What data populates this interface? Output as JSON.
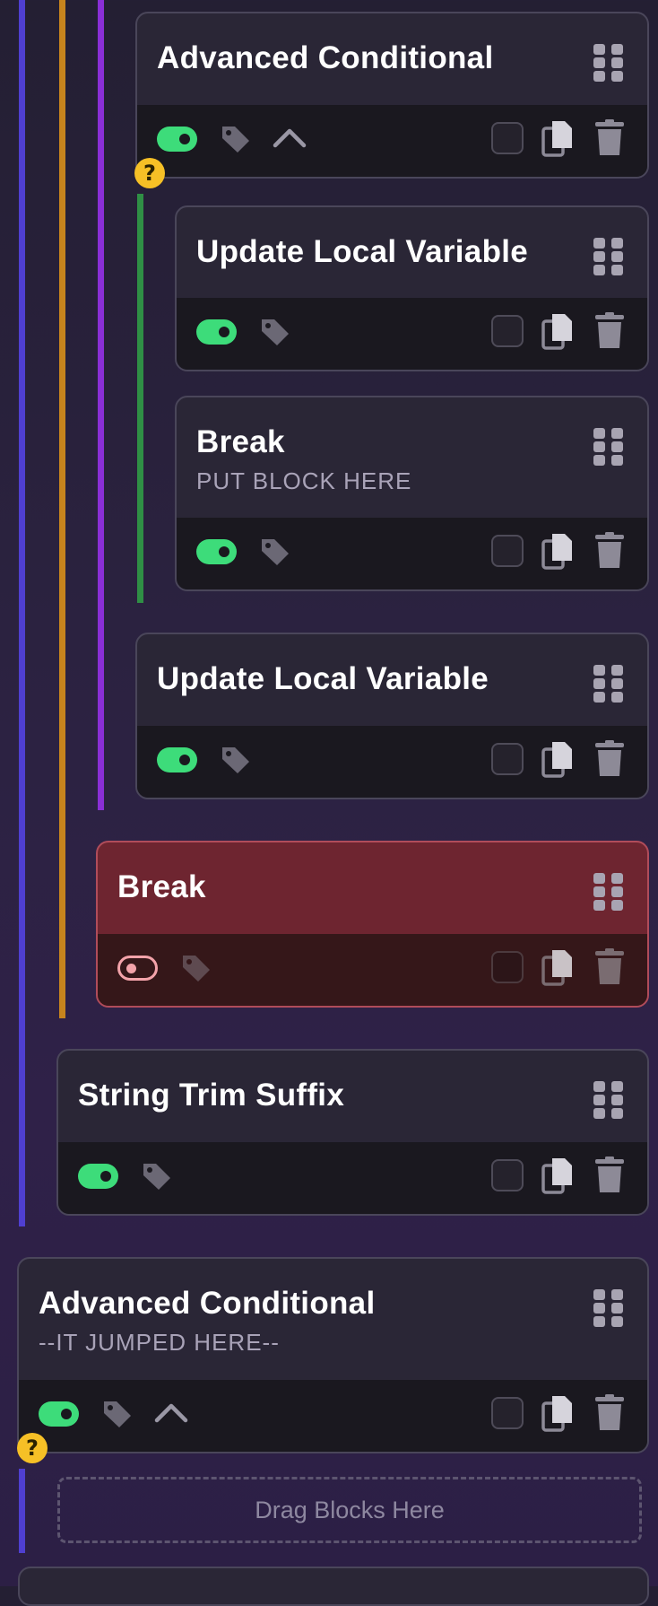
{
  "colors": {
    "nest_line_outer": "#4f3fd0",
    "nest_line_mid": "#c7841d",
    "nest_line_inner": "#8a2fd6",
    "nest_line_green": "#2f8f45",
    "toggle_on": "#3ddc7a",
    "badge": "#f6c026",
    "error_block": "#6e2530"
  },
  "blocks": [
    {
      "title": "Advanced Conditional",
      "enabled": true,
      "icons": [
        "tag-icon",
        "chevron-up-icon"
      ]
    },
    {
      "title": "Update Local Variable",
      "enabled": true,
      "icons": [
        "tag-icon"
      ]
    },
    {
      "title": "Break",
      "subtitle": "PUT BLOCK HERE",
      "enabled": true,
      "icons": [
        "tag-icon"
      ]
    },
    {
      "title": "Update Local Variable",
      "enabled": true,
      "icons": [
        "tag-icon"
      ]
    },
    {
      "title": "Break",
      "enabled": false,
      "state": "error",
      "icons": [
        "tag-icon"
      ]
    },
    {
      "title": "String Trim Suffix",
      "enabled": true,
      "icons": [
        "tag-icon"
      ]
    },
    {
      "title": "Advanced Conditional",
      "subtitle": "--IT JUMPED HERE--",
      "enabled": true,
      "icons": [
        "tag-icon",
        "chevron-up-icon"
      ]
    }
  ],
  "badges": [
    "?",
    "?"
  ],
  "dropzone": {
    "label": "Drag Blocks Here"
  }
}
